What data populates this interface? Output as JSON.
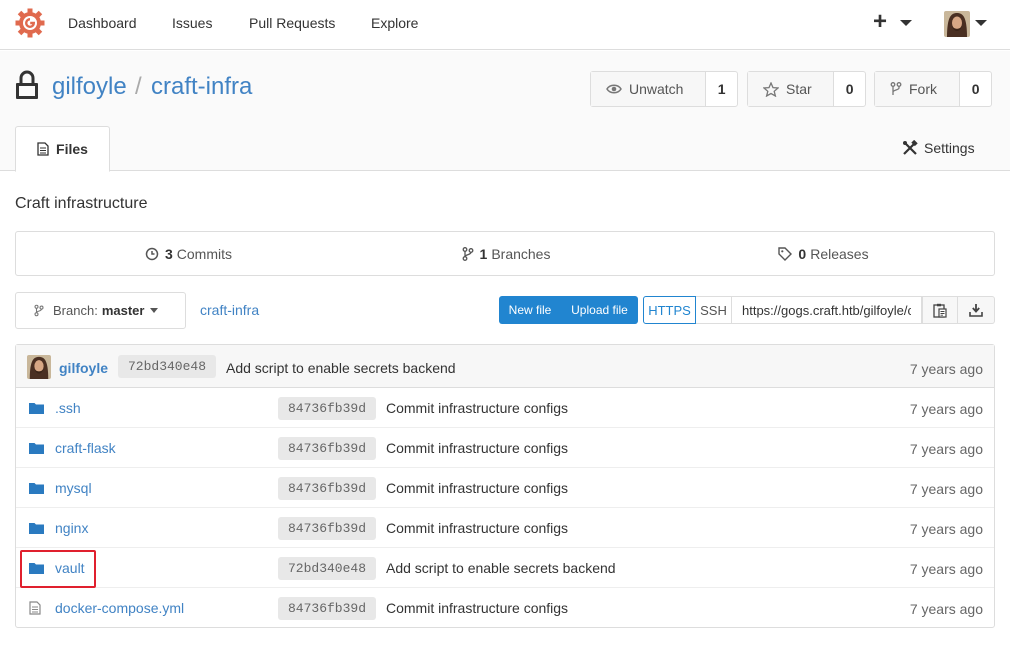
{
  "nav": {
    "items": [
      {
        "label": "Dashboard"
      },
      {
        "label": "Issues"
      },
      {
        "label": "Pull Requests"
      },
      {
        "label": "Explore"
      }
    ],
    "plus_symbol": "+",
    "brand_color": "#e06a4e"
  },
  "repo": {
    "owner": "gilfoyle",
    "separator": "/",
    "name": "craft-infra",
    "watch": {
      "label": "Unwatch",
      "count": "1"
    },
    "star": {
      "label": "Star",
      "count": "0"
    },
    "fork": {
      "label": "Fork",
      "count": "0"
    },
    "tabs": {
      "files": "Files",
      "settings": "Settings"
    },
    "description": "Craft infrastructure"
  },
  "stats": {
    "commits": {
      "count": "3",
      "label": "Commits"
    },
    "branches": {
      "count": "1",
      "label": "Branches"
    },
    "releases": {
      "count": "0",
      "label": "Releases"
    }
  },
  "toolbar": {
    "branch_prefix": "Branch:",
    "branch": "master",
    "breadcrumb": "craft-infra",
    "new_file": "New file",
    "upload_file": "Upload file",
    "https": "HTTPS",
    "ssh": "SSH",
    "clone_url": "https://gogs.craft.htb/gilfoyle/craft-infra.git"
  },
  "latest_commit": {
    "author": "gilfoyle",
    "sha": "72bd340e48",
    "message": "Add script to enable secrets backend",
    "age": "7 years ago"
  },
  "files": [
    {
      "name": ".ssh",
      "type": "folder",
      "sha": "84736fb39d",
      "message": "Commit infrastructure configs",
      "age": "7 years ago"
    },
    {
      "name": "craft-flask",
      "type": "folder",
      "sha": "84736fb39d",
      "message": "Commit infrastructure configs",
      "age": "7 years ago"
    },
    {
      "name": "mysql",
      "type": "folder",
      "sha": "84736fb39d",
      "message": "Commit infrastructure configs",
      "age": "7 years ago"
    },
    {
      "name": "nginx",
      "type": "folder",
      "sha": "84736fb39d",
      "message": "Commit infrastructure configs",
      "age": "7 years ago"
    },
    {
      "name": "vault",
      "type": "folder",
      "sha": "72bd340e48",
      "message": "Add script to enable secrets backend",
      "age": "7 years ago",
      "highlighted": true
    },
    {
      "name": "docker-compose.yml",
      "type": "file",
      "sha": "84736fb39d",
      "message": "Commit infrastructure configs",
      "age": "7 years ago"
    }
  ]
}
